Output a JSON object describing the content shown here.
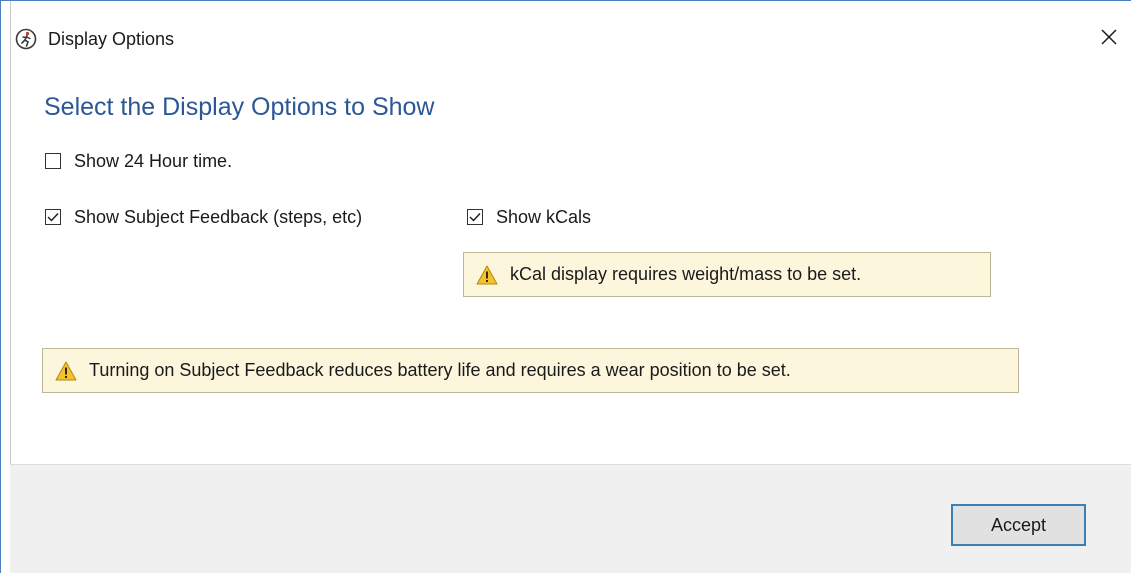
{
  "window": {
    "title": "Display Options",
    "app_icon": "running-figure-icon",
    "close_icon": "close-icon"
  },
  "main": {
    "heading": "Select the Display Options to Show",
    "options": {
      "show_24h": {
        "label": "Show 24 Hour time.",
        "checked": false
      },
      "show_feedback": {
        "label": "Show Subject Feedback (steps, etc)",
        "checked": true
      },
      "show_kcals": {
        "label": "Show kCals",
        "checked": true
      }
    },
    "warnings": {
      "kcal": "kCal display requires weight/mass to be set.",
      "feedback": "Turning on Subject Feedback reduces battery life and requires a wear position to be set."
    }
  },
  "footer": {
    "accept_label": "Accept"
  },
  "colors": {
    "heading": "#2b5797",
    "warning_bg": "#fcf6dd",
    "warning_icon": "#f2c230",
    "accent_border": "#3c7fb1"
  }
}
